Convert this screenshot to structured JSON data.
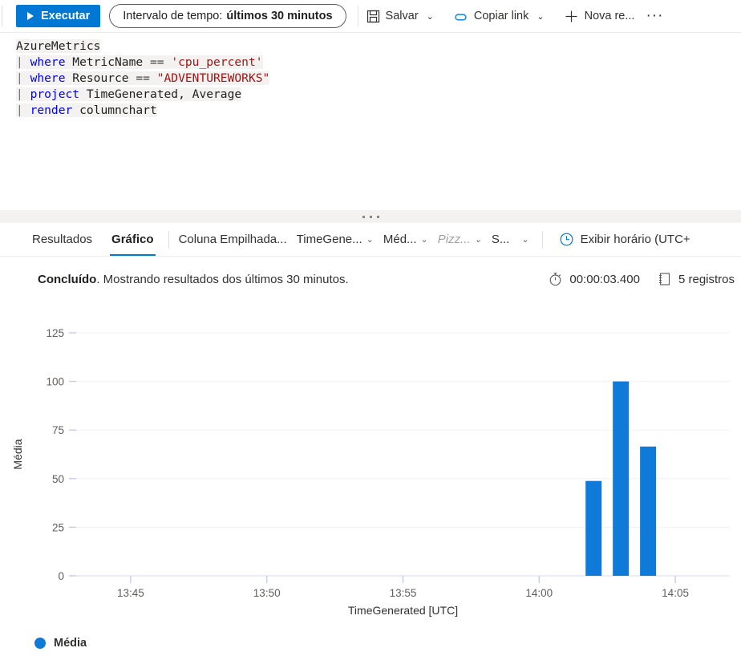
{
  "toolbar": {
    "run_label": "Executar",
    "run_icon": "play-triangle-icon",
    "time_range_label": "Intervalo de tempo:",
    "time_range_value": "últimos 30 minutos",
    "save_label": "Salvar",
    "save_icon": "save-disk-icon",
    "copy_link_label": "Copiar link",
    "copy_link_icon": "link-chain-icon",
    "new_label": "Nova re...",
    "new_icon": "plus-icon",
    "overflow_label": "···",
    "caret": "⌄",
    "accent_color": "#0078d4"
  },
  "editor": {
    "lines": [
      [
        {
          "t": "AzureMetrics",
          "c": "k-table"
        }
      ],
      [
        {
          "t": "| ",
          "c": "k-pipe"
        },
        {
          "t": "where ",
          "c": "k-kw"
        },
        {
          "t": "MetricName ",
          "c": "k-id"
        },
        {
          "t": "== ",
          "c": "k-op"
        },
        {
          "t": "'cpu_percent'",
          "c": "k-str"
        }
      ],
      [
        {
          "t": "| ",
          "c": "k-pipe"
        },
        {
          "t": "where ",
          "c": "k-kw"
        },
        {
          "t": "Resource ",
          "c": "k-id"
        },
        {
          "t": "== ",
          "c": "k-op"
        },
        {
          "t": "\"ADVENTUREWORKS\"",
          "c": "k-str"
        }
      ],
      [
        {
          "t": "| ",
          "c": "k-pipe"
        },
        {
          "t": "project ",
          "c": "k-kw"
        },
        {
          "t": "TimeGenerated, Average",
          "c": "k-id"
        }
      ],
      [
        {
          "t": "| ",
          "c": "k-pipe"
        },
        {
          "t": "render ",
          "c": "k-kw"
        },
        {
          "t": "columnchart",
          "c": "k-id"
        }
      ]
    ]
  },
  "result_tabs": {
    "results_label": "Resultados",
    "chart_label": "Gráfico",
    "active": "Gráfico",
    "chart_type": "Coluna Empilhada...",
    "x_axis": "TimeGene...",
    "y_axis": "Méd...",
    "split_by": "Pizz...",
    "aggregation": "S...",
    "utc_label": "Exibir horário (UTC+",
    "utc_icon": "clock-icon",
    "caret": "⌄"
  },
  "status": {
    "state": "Concluído",
    "message": ". Mostrando resultados dos últimos 30 minutos.",
    "duration_icon": "stopwatch-icon",
    "duration": "00:00:03.400",
    "records_icon": "records-icon",
    "records": "5 registros"
  },
  "chart_data": {
    "type": "bar",
    "title": "",
    "xlabel": "TimeGenerated [UTC]",
    "ylabel": "Média",
    "series_name": "Média",
    "series_color": "#0f7ad8",
    "ylim": [
      0,
      125
    ],
    "yticks": [
      0,
      25,
      50,
      75,
      100,
      125
    ],
    "ytick_labels": [
      "0",
      "25",
      "50",
      "75",
      "100",
      "125"
    ],
    "xticks": [
      "13:45",
      "13:50",
      "13:55",
      "14:00",
      "14:05"
    ],
    "xlim_minutes": [
      43,
      67
    ],
    "grid": true,
    "legend_position": "bottom-left",
    "points": [
      {
        "x": "14:02",
        "x_minutes": 62.0,
        "value": 48.8
      },
      {
        "x": "14:03",
        "x_minutes": 63.0,
        "value": 100.0
      },
      {
        "x": "14:04",
        "x_minutes": 64.0,
        "value": 66.5
      }
    ]
  }
}
